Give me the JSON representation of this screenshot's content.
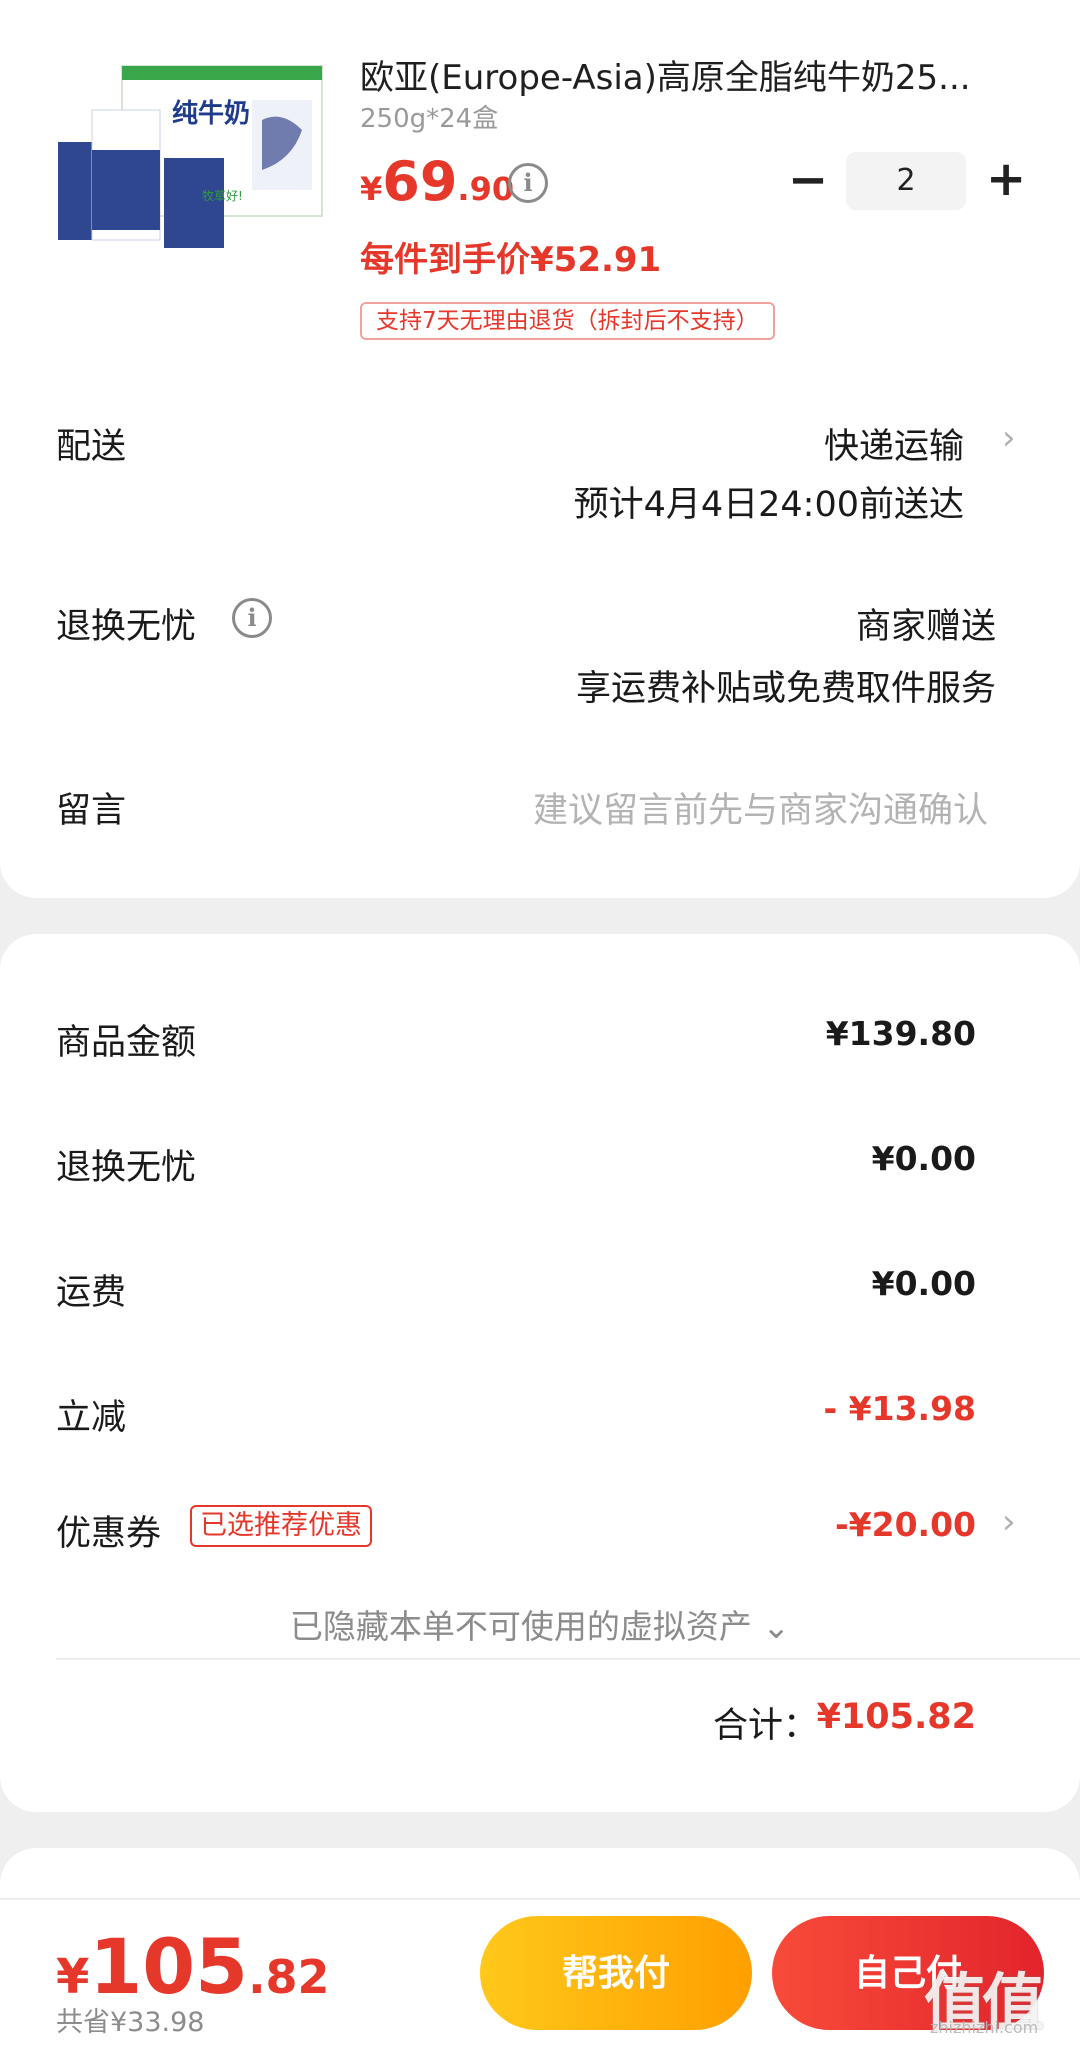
{
  "product": {
    "title": "欧亚(Europe-Asia)高原全脂纯牛奶25...",
    "spec": "250g*24盒",
    "price_currency": "¥",
    "price_int": "69",
    "price_dec": ".90",
    "info_icon": "i",
    "quantity": "2",
    "minus_symbol": "−",
    "plus_symbol": "+",
    "per_item_price": "每件到手价¥52.91",
    "return_policy": "支持7天无理由退货（拆封后不支持）",
    "image_text": "纯牛奶"
  },
  "delivery": {
    "label": "配送",
    "method": "快递运输",
    "eta": "预计4月4日24:00前送达"
  },
  "return_worry": {
    "label": "退换无忧",
    "provider": "商家赠送",
    "service": "享运费补贴或免费取件服务"
  },
  "message": {
    "label": "留言",
    "placeholder": "建议留言前先与商家沟通确认"
  },
  "summary": {
    "rows": [
      {
        "label": "商品金额",
        "value": "¥139.80"
      },
      {
        "label": "退换无忧",
        "value": "¥0.00"
      },
      {
        "label": "运费",
        "value": "¥0.00"
      },
      {
        "label": "立减",
        "value": "- ¥13.98"
      },
      {
        "label": "优惠券",
        "value": "-¥20.00"
      }
    ],
    "coupon_tag": "已选推荐优惠",
    "hidden_assets": "已隐藏本单不可使用的虚拟资产 ⌄",
    "total_label": "合计：",
    "total_value": "¥105.82"
  },
  "bottom": {
    "currency": "¥",
    "total_int": "105",
    "total_dec": ".82",
    "saved": "共省¥33.98",
    "help_pay": "帮我付",
    "self_pay": "自己付"
  },
  "chevron": "›",
  "watermark": "值值值",
  "watermark_sub": "zhizhizhi.com",
  "colors": {
    "accent_red": "#e5372a",
    "help_button": "#ffb20f",
    "self_button": "#ef3432"
  }
}
